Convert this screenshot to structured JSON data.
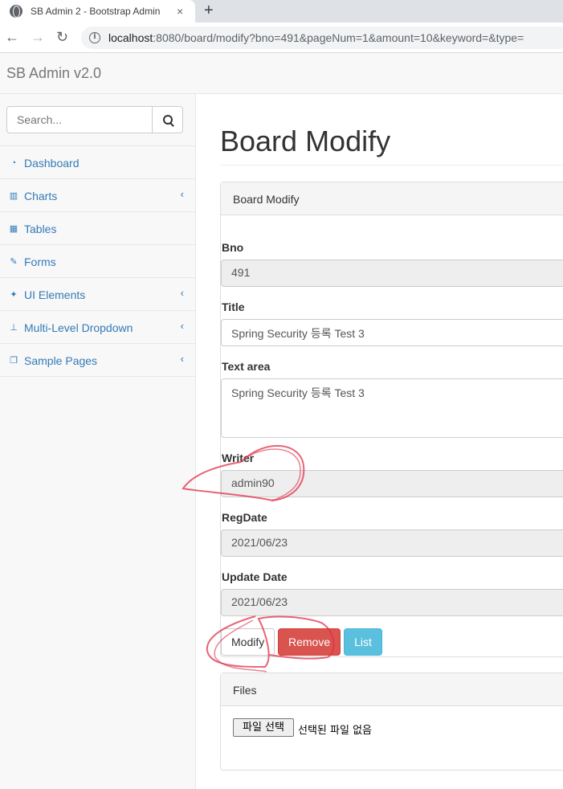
{
  "browser": {
    "tab_title": "SB Admin 2 - Bootstrap Admin",
    "tab_close": "×",
    "new_tab": "+",
    "url_host": "localhost",
    "url_rest": ":8080/board/modify?bno=491&pageNum=1&amount=10&keyword=&type="
  },
  "navbar": {
    "brand": "SB Admin v2.0"
  },
  "sidebar": {
    "search_placeholder": "Search...",
    "items": [
      {
        "label": "Dashboard",
        "icon": "dashboard-icon",
        "has_arrow": false
      },
      {
        "label": "Charts",
        "icon": "bar-chart-icon",
        "has_arrow": true
      },
      {
        "label": "Tables",
        "icon": "table-icon",
        "has_arrow": false
      },
      {
        "label": "Forms",
        "icon": "edit-icon",
        "has_arrow": false
      },
      {
        "label": "UI Elements",
        "icon": "wrench-icon",
        "has_arrow": true
      },
      {
        "label": "Multi-Level Dropdown",
        "icon": "sitemap-icon",
        "has_arrow": true
      },
      {
        "label": "Sample Pages",
        "icon": "files-icon",
        "has_arrow": true
      }
    ],
    "arrow_glyph": "‹"
  },
  "page": {
    "title": "Board Modify",
    "panel_heading": "Board Modify",
    "fields": {
      "bno": {
        "label": "Bno",
        "value": "491"
      },
      "title": {
        "label": "Title",
        "value": "Spring Security 등록 Test 3"
      },
      "content": {
        "label": "Text area",
        "value": "Spring Security 등록 Test 3"
      },
      "writer": {
        "label": "Writer",
        "value": "admin90"
      },
      "regdate": {
        "label": "RegDate",
        "value": "2021/06/23"
      },
      "updatedate": {
        "label": "Update Date",
        "value": "2021/06/23"
      }
    },
    "buttons": {
      "modify": "Modify",
      "remove": "Remove",
      "list": "List"
    },
    "files": {
      "heading": "Files",
      "choose_button": "파일 선택",
      "status": "선택된 파일 없음"
    }
  },
  "colors": {
    "link": "#337ab7",
    "danger": "#d9534f",
    "info": "#5bc0de",
    "annotation": "#e0304a"
  }
}
